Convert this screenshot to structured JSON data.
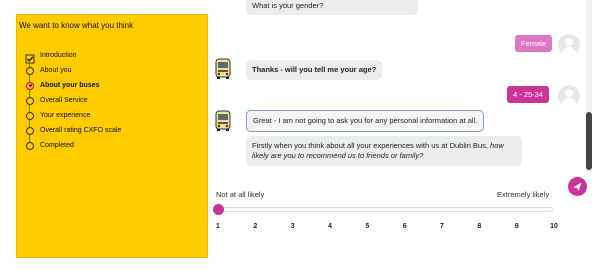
{
  "sidebar": {
    "title": "We want to know what you think",
    "steps": [
      {
        "label": "Introduction",
        "state": "done"
      },
      {
        "label": "About you",
        "state": "todo"
      },
      {
        "label": "About your buses",
        "state": "current"
      },
      {
        "label": "Overall Service",
        "state": "todo"
      },
      {
        "label": "Your experience",
        "state": "todo"
      },
      {
        "label": "Overall rating CXFO scale",
        "state": "todo"
      },
      {
        "label": "Completed",
        "state": "todo"
      }
    ]
  },
  "chat": {
    "top_cut_message": "What is your gender?",
    "user_answer_gender": "Female",
    "bot_age_question": "Thanks - will you tell me your age?",
    "user_answer_age": "4 - 25-34",
    "bot_not_ask": "Great - I am not going to ask you for any personal information at all.",
    "bot_recommend_prefix": "Firstly when you think about all your experiences with us at Dublin Bus, ",
    "bot_recommend_italic": "how likely are you to recommend us to friends or family?"
  },
  "scale": {
    "low_label": "Not at all likely",
    "high_label": "Extremely likely",
    "ticks": [
      "1",
      "2",
      "3",
      "4",
      "5",
      "6",
      "7",
      "8",
      "9",
      "10"
    ],
    "selected_value": 1
  },
  "colors": {
    "accent": "#cc3399",
    "sidebar_bg": "#ffcc00"
  },
  "icons": {
    "send": "send-icon",
    "bot": "bus-icon",
    "user": "user-avatar-icon"
  }
}
